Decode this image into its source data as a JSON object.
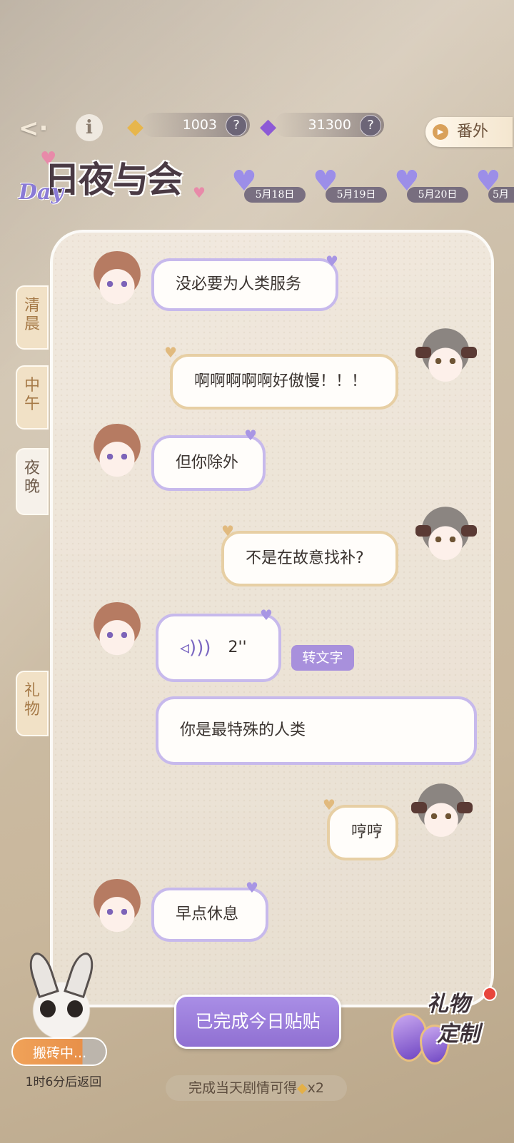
{
  "currencies": {
    "gold": {
      "value": "1003",
      "help": "?"
    },
    "purple": {
      "value": "31300",
      "help": "?"
    }
  },
  "header": {
    "back_icon": "<·",
    "info_icon": "i",
    "extra_label": "番外",
    "title": "日夜与会",
    "title_sub": "Day"
  },
  "dates": [
    "5月18日",
    "5月19日",
    "5月20日",
    "5月"
  ],
  "side_tabs": {
    "morning": "清晨",
    "noon": "中午",
    "night": "夜晚",
    "gift": "礼物"
  },
  "chat": {
    "messages": [
      {
        "from": "him",
        "text": "没必要为人类服务"
      },
      {
        "from": "her",
        "text": "啊啊啊啊啊好傲慢！！！"
      },
      {
        "from": "him",
        "text": "但你除外"
      },
      {
        "from": "her",
        "text": "不是在故意找补?"
      },
      {
        "from": "him",
        "type": "voice",
        "text": "2''"
      },
      {
        "from": "him",
        "text": "你是最特殊的人类"
      },
      {
        "from": "her",
        "text": "哼哼"
      },
      {
        "from": "him",
        "text": "早点休息"
      }
    ],
    "to_text_label": "转文字"
  },
  "bottom": {
    "done_label": "已完成今日贴贴",
    "reward_label": "完成当天剧情可得",
    "reward_count": "x2",
    "busy_label": "搬砖中...",
    "return_label": "1时6分后返回",
    "gift_line1": "礼物",
    "gift_line2": "定制"
  }
}
